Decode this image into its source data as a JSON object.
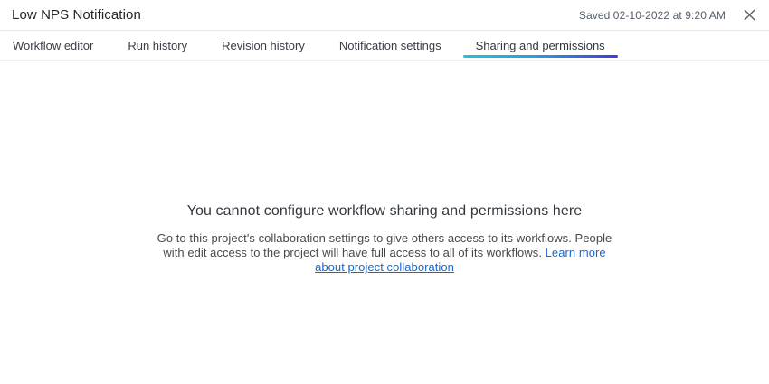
{
  "header": {
    "title": "Low NPS Notification",
    "saved_status": "Saved 02-10-2022 at 9:20 AM"
  },
  "tabs": [
    {
      "label": "Workflow editor",
      "active": false
    },
    {
      "label": "Run history",
      "active": false
    },
    {
      "label": "Revision history",
      "active": false
    },
    {
      "label": "Notification settings",
      "active": false
    },
    {
      "label": "Sharing and permissions",
      "active": true
    }
  ],
  "content": {
    "heading": "You cannot configure workflow sharing and permissions here",
    "body": "Go to this project's collaboration settings to give others access to its workflows. People with edit access to the project will have full access to all of its workflows. ",
    "link_label": "Learn more about project collaboration"
  },
  "colors": {
    "accent_gradient_start": "#1fc4d6",
    "accent_gradient_end": "#4238e0",
    "link": "#1568d3",
    "heading_text": "#33383e",
    "body_text": "#45494e"
  }
}
